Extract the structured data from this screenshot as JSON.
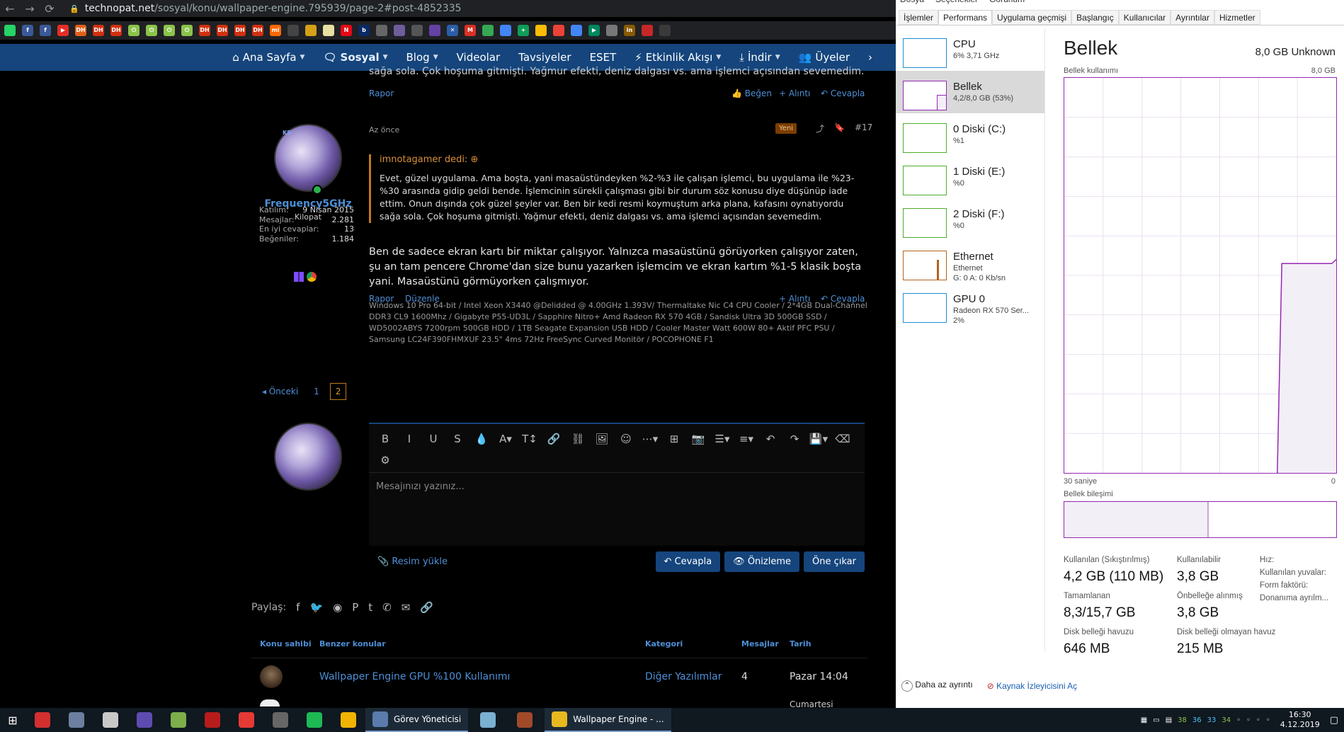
{
  "browser": {
    "url_host": "technopat.net",
    "url_path": "/sosyal/konu/wallpaper-engine.795939/page-2#post-4852335",
    "nav_icons": [
      "back-icon",
      "forward-icon",
      "reload-icon"
    ],
    "bookmarks": [
      {
        "icon": "whatsapp-icon",
        "label": "",
        "color": "#25d366"
      },
      {
        "icon": "facebook-icon",
        "label": "f",
        "color": "#3b5998"
      },
      {
        "icon": "facebook-icon",
        "label": "f",
        "color": "#3b5998"
      },
      {
        "icon": "youtube-icon",
        "label": "▶",
        "color": "#e52d27"
      },
      {
        "icon": "dh-icon",
        "label": "DH",
        "color": "#e0601a"
      },
      {
        "icon": "dh-icon",
        "label": "DH",
        "color": "#d03010"
      },
      {
        "icon": "dh-icon",
        "label": "DH",
        "color": "#d03010"
      },
      {
        "icon": "power-icon",
        "label": "⏻",
        "color": "#8bc34a"
      },
      {
        "icon": "power-icon",
        "label": "⏻",
        "color": "#8bc34a"
      },
      {
        "icon": "power-icon",
        "label": "⏻",
        "color": "#8bc34a"
      },
      {
        "icon": "power-icon",
        "label": "⏻",
        "color": "#8bc34a"
      },
      {
        "icon": "dh-icon",
        "label": "DH",
        "color": "#d03010"
      },
      {
        "icon": "dh-icon",
        "label": "DH",
        "color": "#d03010"
      },
      {
        "icon": "dh-icon",
        "label": "DH",
        "color": "#d03010"
      },
      {
        "icon": "dh-icon",
        "label": "DH",
        "color": "#d03010"
      },
      {
        "icon": "mi-icon",
        "label": "mi",
        "color": "#ff6700"
      },
      {
        "icon": "game-icon",
        "label": "",
        "color": "#444"
      },
      {
        "icon": "circle-icon",
        "label": "",
        "color": "#d4a017"
      },
      {
        "icon": "square-icon",
        "label": "",
        "color": "#e8e0a0"
      },
      {
        "icon": "netflix-icon",
        "label": "N",
        "color": "#e50914"
      },
      {
        "icon": "b-icon",
        "label": "b",
        "color": "#0a2a66"
      },
      {
        "icon": "globe-icon",
        "label": "",
        "color": "#666"
      },
      {
        "icon": "tv-icon",
        "label": "",
        "color": "#6d5d9c"
      },
      {
        "icon": "link-icon",
        "label": "",
        "color": "#555"
      },
      {
        "icon": "twitch-icon",
        "label": "",
        "color": "#6441a5"
      },
      {
        "icon": "x-icon",
        "label": "✕",
        "color": "#2b5ea8"
      },
      {
        "icon": "mail-icon",
        "label": "M",
        "color": "#d93025"
      },
      {
        "icon": "drive-icon",
        "label": "",
        "color": "#34a853"
      },
      {
        "icon": "docs-icon",
        "label": "",
        "color": "#4285f4"
      },
      {
        "icon": "sheets-icon",
        "label": "+",
        "color": "#0f9d58"
      },
      {
        "icon": "keep-icon",
        "label": "",
        "color": "#fbbc04"
      },
      {
        "icon": "photos-icon",
        "label": "",
        "color": "#ea4335"
      },
      {
        "icon": "translate-icon",
        "label": "",
        "color": "#4285f4"
      },
      {
        "icon": "play-icon",
        "label": "▶",
        "color": "#01875f"
      },
      {
        "icon": "globe-icon",
        "label": "",
        "color": "#777"
      },
      {
        "icon": "in-icon",
        "label": "in",
        "color": "#8a5a00"
      },
      {
        "icon": "shield-icon",
        "label": "",
        "color": "#c62828"
      },
      {
        "icon": "box-icon",
        "label": "",
        "color": "#3a3a3a"
      }
    ]
  },
  "site_nav": [
    {
      "icon": "home-icon",
      "glyph": "⌂",
      "label": "Ana Sayfa",
      "caret": true,
      "active": false
    },
    {
      "icon": "chat-icon",
      "glyph": "🗨",
      "label": "Sosyal",
      "caret": true,
      "active": true
    },
    {
      "icon": "",
      "glyph": "",
      "label": "Blog",
      "caret": true,
      "active": false
    },
    {
      "icon": "",
      "glyph": "",
      "label": "Videolar",
      "caret": false,
      "active": false
    },
    {
      "icon": "",
      "glyph": "",
      "label": "Tavsiyeler",
      "caret": false,
      "active": false
    },
    {
      "icon": "",
      "glyph": "",
      "label": "ESET",
      "caret": false,
      "active": false
    },
    {
      "icon": "bolt-icon",
      "glyph": "⚡",
      "label": "Etkinlik Akışı",
      "caret": true,
      "active": false
    },
    {
      "icon": "download-icon",
      "glyph": "⤓",
      "label": "İndir",
      "caret": true,
      "active": false
    },
    {
      "icon": "users-icon",
      "glyph": "👥",
      "label": "Üyeler",
      "caret": false,
      "active": false
    }
  ],
  "prev_post": {
    "cut_text": "sağa sola. Çok hoşuma gitmişti. Yağmur efekti, deniz dalgası vs. ama işlemci açısından sevemedim.",
    "report": "Rapor",
    "like": "Beğen",
    "quote": "+ Alıntı",
    "reply": "Cevapla"
  },
  "post": {
    "username": "Frequency5GHz",
    "avatar_initials": "KS",
    "user_title": "Kilopat",
    "stats": [
      {
        "k": "Katılım:",
        "v": "9 Nisan 2015"
      },
      {
        "k": "Mesajlar:",
        "v": "2.281"
      },
      {
        "k": "En iyi cevaplar:",
        "v": "13"
      },
      {
        "k": "Beğeniler:",
        "v": "1.184"
      }
    ],
    "date": "Az önce",
    "badge": "Yeni",
    "number": "#17",
    "quote_head": "imnotagamer dedi:",
    "quote_body": "Evet, güzel uygulama. Ama boşta, yani masaüstündeyken %2-%3 ile çalışan işlemci, bu uygulama ile %23-%30 arasında gidip geldi bende. İşlemcinin sürekli çalışması gibi bir durum söz konusu diye düşünüp iade ettim. Onun dışında çok güzel şeyler var. Ben bir kedi resmi koymuştum arka plana, kafasını oynatıyordu sağa sola. Çok hoşuma gitmişti. Yağmur efekti, deniz dalgası vs. ama işlemci açısından sevemedim.",
    "message": "Ben de sadece ekran kartı bir miktar çalışıyor. Yalnızca masaüstünü görüyorken çalışıyor zaten, şu an tam pencere Chrome'dan size bunu yazarken işlemcim ve ekran kartım %1-5 klasik boşta yani. Masaüstünü görmüyorken çalışmıyor.",
    "signature": "Windows 10 Pro 64-bit / Intel Xeon X3440 @Delidded @ 4.00GHz 1.393V/ Thermaltake Nic C4 CPU Cooler / 2*4GB Dual-Channel DDR3 CL9 1600Mhz / Gigabyte P55-UD3L / Sapphire Nitro+ Amd Radeon RX 570 4GB / Sandisk Ultra 3D 500GB SSD / WD5002ABYS 7200rpm 500GB HDD / 1TB Seagate Expansion USB HDD / Cooler Master Watt 600W 80+ Aktif PFC PSU / Samsung LC24F390FHMXUF 23.5\" 4ms 72Hz FreeSync Curved Monitör / POCOPHONE F1",
    "report": "Rapor",
    "edit": "Düzenle",
    "quote": "+ Alıntı",
    "reply": "Cevapla"
  },
  "pager": {
    "prev": "◂ Önceki",
    "pages": [
      "1",
      "2"
    ],
    "current": "2"
  },
  "editor": {
    "placeholder": "Mesajınızı yazınız...",
    "upload": "Resim yükle",
    "reply_btn": "Cevapla",
    "preview_btn": "Önizleme",
    "highlight_btn": "Öne çıkar",
    "tools": [
      {
        "icon": "bold-icon",
        "g": "B"
      },
      {
        "icon": "italic-icon",
        "g": "I"
      },
      {
        "icon": "underline-icon",
        "g": "U"
      },
      {
        "icon": "strike-icon",
        "g": "S"
      },
      {
        "icon": "color-icon",
        "g": "💧"
      },
      {
        "icon": "font-icon",
        "g": "A▾"
      },
      {
        "icon": "font-size-icon",
        "g": "T↕"
      },
      {
        "icon": "link-icon",
        "g": "🔗"
      },
      {
        "icon": "unlink-icon",
        "g": "⛓"
      },
      {
        "icon": "image-icon",
        "g": "🖼"
      },
      {
        "icon": "emoji-icon",
        "g": "☺"
      },
      {
        "icon": "more-icon",
        "g": "⋯▾"
      },
      {
        "icon": "table-icon",
        "g": "⊞"
      },
      {
        "icon": "camera-icon",
        "g": "📷"
      },
      {
        "icon": "list-icon",
        "g": "☰▾"
      },
      {
        "icon": "align-icon",
        "g": "≡▾"
      },
      {
        "icon": "undo-icon",
        "g": "↶"
      },
      {
        "icon": "redo-icon",
        "g": "↷"
      },
      {
        "icon": "save-draft-icon",
        "g": "💾▾"
      },
      {
        "icon": "eraser-icon",
        "g": "⌫"
      },
      {
        "icon": "settings-icon",
        "g": "⚙"
      }
    ]
  },
  "share": {
    "label": "Paylaş:",
    "icons": [
      {
        "icon": "facebook-icon",
        "g": "f"
      },
      {
        "icon": "twitter-icon",
        "g": "🐦"
      },
      {
        "icon": "reddit-icon",
        "g": "◉"
      },
      {
        "icon": "pinterest-icon",
        "g": "P"
      },
      {
        "icon": "tumblr-icon",
        "g": "t"
      },
      {
        "icon": "whatsapp-icon",
        "g": "✆"
      },
      {
        "icon": "email-icon",
        "g": "✉"
      },
      {
        "icon": "link-icon",
        "g": "🔗"
      }
    ]
  },
  "similar": {
    "headers": [
      "Konu sahibi",
      "Benzer konular",
      "Kategori",
      "Mesajlar",
      "Tarih"
    ],
    "rows": [
      {
        "title": "Wallpaper Engine GPU %100 Kullanımı",
        "category": "Diğer Yazılımlar",
        "messages": "4",
        "date": "Pazar 14:04"
      }
    ],
    "cut_row_date": "Cumartesi"
  },
  "taskmgr": {
    "menu": [
      "Dosya",
      "Seçenekler",
      "Görünüm"
    ],
    "tabs": [
      "İşlemler",
      "Performans",
      "Uygulama geçmişi",
      "Başlangıç",
      "Kullanıcılar",
      "Ayrıntılar",
      "Hizmetler"
    ],
    "selected_tab": "Performans",
    "resources": [
      {
        "name": "CPU",
        "sub": "6% 3,71 GHz",
        "sub2": "",
        "color": "#1f8dd6",
        "sel": false
      },
      {
        "name": "Bellek",
        "sub": "4,2/8,0 GB (53%)",
        "sub2": "",
        "color": "#9528b4",
        "sel": true
      },
      {
        "name": "0 Diski (C:)",
        "sub": "%1",
        "sub2": "",
        "color": "#4cae2b",
        "sel": false
      },
      {
        "name": "1 Diski (E:)",
        "sub": "%0",
        "sub2": "",
        "color": "#4cae2b",
        "sel": false
      },
      {
        "name": "2 Diski (F:)",
        "sub": "%0",
        "sub2": "",
        "color": "#4cae2b",
        "sel": false
      },
      {
        "name": "Ethernet",
        "sub": "Ethernet",
        "sub2": "G: 0 A: 0 Kb/sn",
        "color": "#b3631a",
        "sel": false
      },
      {
        "name": "GPU 0",
        "sub": "Radeon RX 570 Ser...",
        "sub2": "2%",
        "color": "#1f8dd6",
        "sel": false
      }
    ],
    "title": "Bellek",
    "total": "8,0 GB Unknown",
    "usage_label": "Bellek kullanımı",
    "usage_max": "8,0 GB",
    "time_label": "30 saniye",
    "time_end": "0",
    "composition_label": "Bellek bileşimi",
    "stats": {
      "in_use_label": "Kullanılan (Sıkıştırılmış)",
      "in_use": "4,2 GB (110 MB)",
      "available_label": "Kullanılabilir",
      "available": "3,8 GB",
      "committed_label": "Tamamlanan",
      "committed": "8,3/15,7 GB",
      "cached_label": "Önbelleğe alınmış",
      "cached": "3,8 GB",
      "paged_label": "Disk belleği havuzu",
      "paged": "646 MB",
      "nonpaged_label": "Disk belleği olmayan havuz",
      "nonpaged": "215 MB",
      "speed_label": "Hız:",
      "slots_label": "Kullanılan yuvalar:",
      "form_label": "Form faktörü:",
      "reserved_label": "Donanıma ayrılm..."
    },
    "usage_history": [
      0,
      0,
      0,
      0,
      0,
      0,
      0,
      0,
      0,
      0,
      0,
      0,
      0,
      0,
      0,
      0,
      0,
      0,
      0,
      0,
      0,
      0,
      0,
      0,
      0,
      0,
      0,
      0,
      0,
      0,
      0,
      0,
      0,
      0,
      0,
      0,
      0,
      0,
      0,
      0,
      0,
      0,
      0,
      0,
      0,
      0,
      0,
      0,
      0.53,
      0.53,
      0.53,
      0.53,
      0.53,
      0.53,
      0.53,
      0.53,
      0.53,
      0.53,
      0.53,
      0.53,
      0.54
    ],
    "composition_in_use": 0.53,
    "footer_less": "Daha az ayrıntı",
    "footer_monitor": "Kaynak İzleyicisini Aç"
  },
  "taskbar": {
    "apps": [
      {
        "icon": "app-red-icon",
        "color": "#d32f2f"
      },
      {
        "icon": "book-icon",
        "color": "#6d7fa0"
      },
      {
        "icon": "tool-icon",
        "color": "#c8c8c8"
      },
      {
        "icon": "chip-icon",
        "color": "#5e4bb0"
      },
      {
        "icon": "monitor-icon",
        "color": "#7cae4a"
      },
      {
        "icon": "cpu-z-icon",
        "color": "#b71c1c"
      },
      {
        "icon": "bolt-icon",
        "color": "#e53935"
      },
      {
        "icon": "calculator-icon",
        "color": "#666"
      },
      {
        "icon": "spotify-icon",
        "color": "#1db954"
      },
      {
        "icon": "folder-icon",
        "color": "#f0b400"
      }
    ],
    "running": [
      {
        "icon": "task-manager-icon",
        "label": "Görev Yöneticisi",
        "color": "#5a7bab"
      },
      {
        "icon": "app-icon",
        "label": "",
        "color": "#7ab0d0"
      },
      {
        "icon": "game-icon",
        "label": "",
        "color": "#a04a2a"
      },
      {
        "icon": "chrome-icon",
        "label": "Wallpaper Engine - ...",
        "color": "#e8b820"
      }
    ],
    "tray_numbers": [
      "38",
      "36",
      "33",
      "34"
    ],
    "time": "16:30",
    "date": "4.12.2019"
  }
}
